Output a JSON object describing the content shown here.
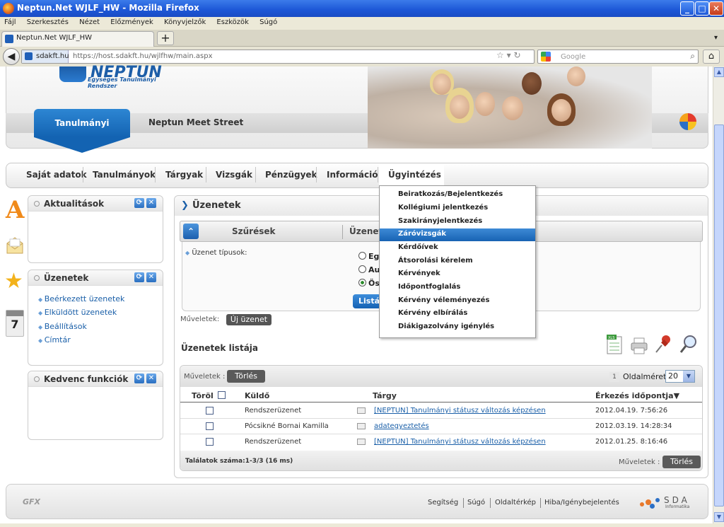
{
  "window": {
    "title": "Neptun.Net WJLF_HW - Mozilla Firefox",
    "min": "_",
    "max": "□",
    "close": "✕"
  },
  "menu": [
    "Fájl",
    "Szerkesztés",
    "Nézet",
    "Előzmények",
    "Könyvjelzők",
    "Eszközök",
    "Súgó"
  ],
  "browser": {
    "tab_title": "Neptun.Net WJLF_HW",
    "new_tab": "+",
    "site_identity": "sdakft.hu",
    "url": "https://host.sdakft.hu/wjlfhw/main.aspx",
    "search_placeholder": "Google"
  },
  "header": {
    "logo_word": "NEPTUN",
    "logo_sub": "Egységes Tanulmányi Rendszer",
    "tab_active": "Tanulmányi rendszer",
    "tab_other": "Neptun Meet Street"
  },
  "nav": [
    "Saját adatok",
    "Tanulmányok",
    "Tárgyak",
    "Vizsgák",
    "Pénzügyek",
    "Információ",
    "Ügyintézés"
  ],
  "dropdown": [
    "Beiratkozás/Bejelentkezés",
    "Kollégiumi jelentkezés",
    "Szakirányjelentkezés",
    "Záróvizsgák",
    "Kérdőívek",
    "Átsorolási kérelem",
    "Kérvények",
    "Időpontfoglalás",
    "Kérvény véleményezés",
    "Kérvény elbírálás",
    "Diákigazolvány igénylés"
  ],
  "dropdown_highlighted": "Záróvizsgák",
  "left_icons": {
    "a_glyph": "A",
    "star_glyph": "★",
    "calendar_day": "7"
  },
  "panels": {
    "aktualitasok": {
      "title": "Aktualitások"
    },
    "uzenetek": {
      "title": "Üzenetek",
      "links": [
        "Beérkezett üzenetek",
        "Elküldött üzenetek",
        "Beállítások",
        "Címtár"
      ]
    },
    "kedvenc": {
      "title": "Kedvenc funkciók"
    }
  },
  "messages": {
    "title": "Üzenetek",
    "filter_label": "Szűrések",
    "filter_label2": "Üzenet",
    "message_types_label": "Üzenet típusok:",
    "radio_options": [
      "Eg",
      "Au",
      "Ös"
    ],
    "list_button": "Listá",
    "operations_label": "Műveletek:",
    "new_message_button": "Új üzenet",
    "list_title": "Üzenetek listája",
    "operations_label2": "Műveletek :",
    "delete_button": "Törlés",
    "page_number": "1",
    "page_size_label": "Oldalméret",
    "page_size": "20",
    "columns": [
      "Töröl",
      "Küldő",
      "Tárgy",
      "Érkezés időpontja"
    ],
    "rows": [
      {
        "sender": "Rendszerüzenet",
        "subject": "[NEPTUN] Tanulmányi státusz változás képzésen",
        "date": "2012.04.19. 7:56:26"
      },
      {
        "sender": "Pócsikné Bornai Kamilla",
        "subject": "adategyeztetés",
        "date": "2012.03.19. 14:28:34"
      },
      {
        "sender": "Rendszerüzenet",
        "subject": "[NEPTUN] Tanulmányi státusz változás képzésen",
        "date": "2012.01.25. 8:16:46"
      }
    ],
    "results": "Találatok száma:1-3/3 (16 ms)"
  },
  "footer": {
    "gfx": "GFX",
    "links": [
      "Segítség",
      "Súgó",
      "Oldaltérkép",
      "Hiba/Igénybejelentés"
    ],
    "sda": "SDA",
    "sda_sub": "Informatika"
  }
}
